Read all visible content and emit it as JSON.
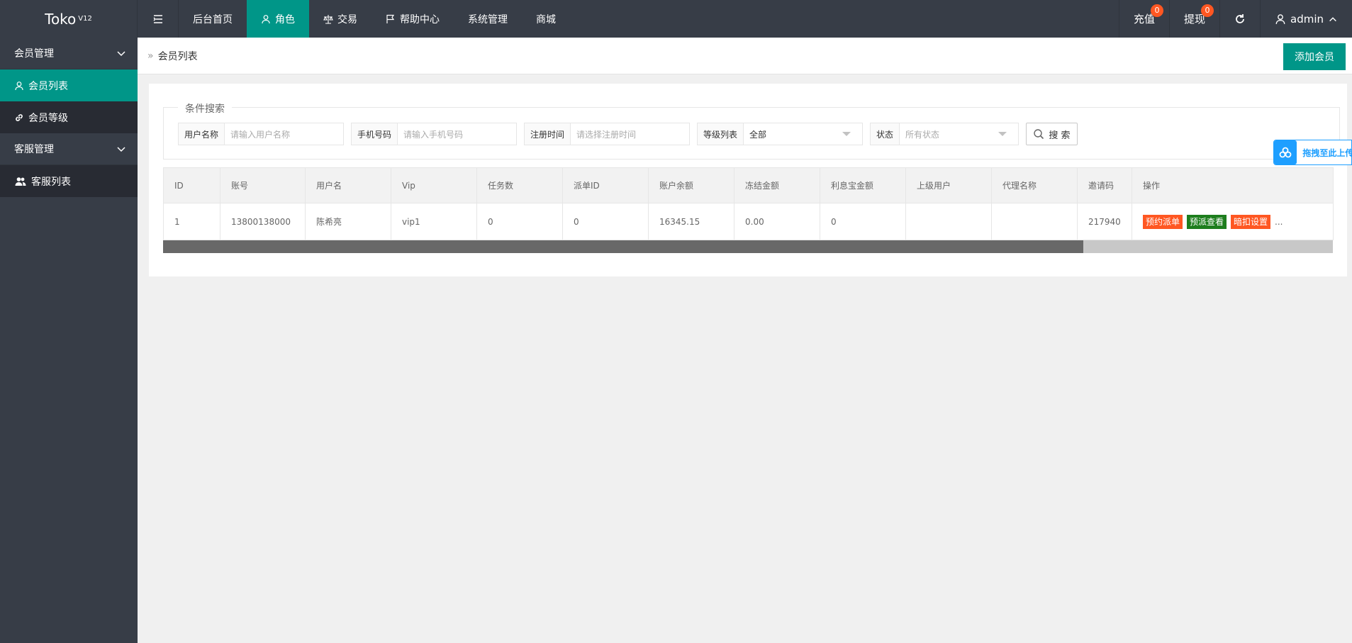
{
  "app": {
    "title": "Toko",
    "version": "V12"
  },
  "nav": {
    "items": [
      {
        "label": "后台首页"
      },
      {
        "label": "角色"
      },
      {
        "label": "交易"
      },
      {
        "label": "帮助中心"
      },
      {
        "label": "系统管理"
      },
      {
        "label": "商城"
      }
    ]
  },
  "header_right": {
    "recharge_label": "充值",
    "recharge_badge": "0",
    "withdraw_label": "提现",
    "withdraw_badge": "0",
    "user_label": "admin"
  },
  "sidebar": {
    "groups": [
      {
        "label": "会员管理",
        "items": [
          {
            "label": "会员列表"
          },
          {
            "label": "会员等级"
          }
        ]
      },
      {
        "label": "客服管理",
        "items": [
          {
            "label": "客服列表"
          }
        ]
      }
    ]
  },
  "breadcrumb": {
    "current": "会员列表"
  },
  "add_button": "添加会员",
  "search": {
    "legend": "条件搜索",
    "fields": [
      {
        "label": "用户名称",
        "placeholder": "请输入用户名称"
      },
      {
        "label": "手机号码",
        "placeholder": "请输入手机号码"
      },
      {
        "label": "注册时间",
        "placeholder": "请选择注册时间"
      },
      {
        "label": "等级列表",
        "value": "全部"
      },
      {
        "label": "状态",
        "placeholder": "所有状态"
      }
    ],
    "button": "搜 索"
  },
  "table": {
    "headers": [
      "ID",
      "账号",
      "用户名",
      "Vip",
      "任务数",
      "派单ID",
      "账户余额",
      "冻结金额",
      "利息宝金额",
      "上级用户",
      "代理名称",
      "邀请码",
      "操作"
    ],
    "rows": [
      {
        "cells": [
          "1",
          "13800138000",
          "陈希亮",
          "vip1",
          "0",
          "0",
          "16345.15",
          "0.00",
          "0",
          "",
          "",
          "217940"
        ],
        "actions": [
          "预约派单",
          "预派查看",
          "暗扣设置"
        ],
        "more": "..."
      }
    ]
  },
  "float_upload": {
    "text": "拖拽至此上传"
  },
  "colors": {
    "header_bg": "#373d47",
    "accent": "#009688",
    "badge": "#ff5722",
    "upload_blue": "#1e9fff"
  }
}
